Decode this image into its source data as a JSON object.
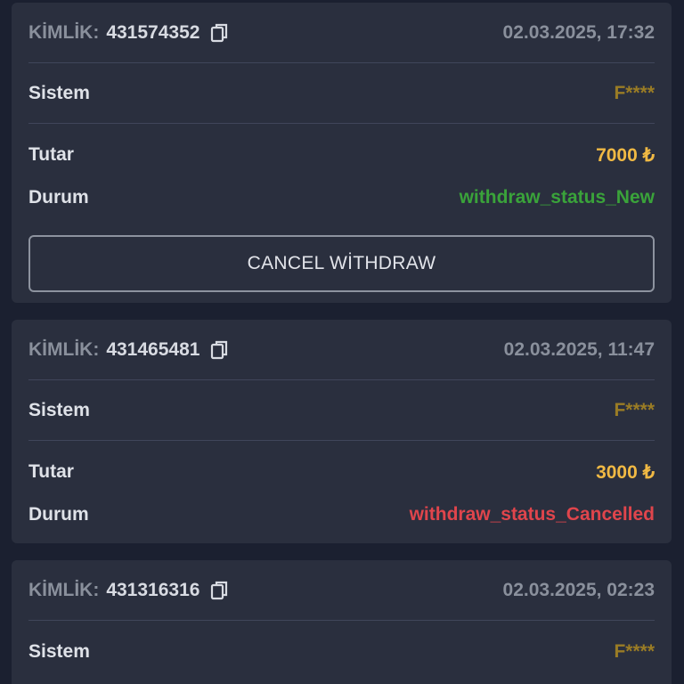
{
  "cards": [
    {
      "id_label": "KİMLİK:",
      "id_value": "431574352",
      "date": "02.03.2025, 17:32",
      "system_label": "Sistem",
      "system_value": "F****",
      "amount_label": "Tutar",
      "amount_value": "7000 ₺",
      "status_label": "Durum",
      "status_value": "withdraw_status_New",
      "cancel_button": "CANCEL WİTHDRAW"
    },
    {
      "id_label": "KİMLİK:",
      "id_value": "431465481",
      "date": "02.03.2025, 11:47",
      "system_label": "Sistem",
      "system_value": "F****",
      "amount_label": "Tutar",
      "amount_value": "3000 ₺",
      "status_label": "Durum",
      "status_value": "withdraw_status_Cancelled"
    },
    {
      "id_label": "KİMLİK:",
      "id_value": "431316316",
      "date": "02.03.2025, 02:23",
      "system_label": "Sistem",
      "system_value": "F****"
    }
  ],
  "icons": {
    "copy": "copy-icon"
  },
  "colors": {
    "background": "#1b2030",
    "card": "#2a2f3e",
    "amount": "#f0b944",
    "system": "#9a7c25",
    "status_new": "#3aa33a",
    "status_cancelled": "#e0454c"
  }
}
